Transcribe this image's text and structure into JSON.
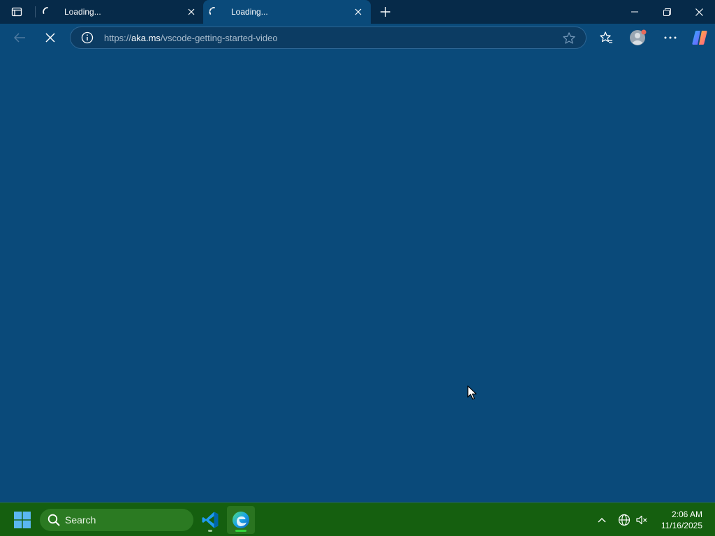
{
  "browser": {
    "tabs": [
      {
        "title": "Loading...",
        "state": "loading",
        "active": false
      },
      {
        "title": "Loading...",
        "state": "loading",
        "active": true
      }
    ],
    "address": {
      "url_prefix": "https://",
      "url_host": "aka.ms",
      "url_path": "/vscode-getting-started-video"
    },
    "icons": {
      "tab_actions": "tab-actions-icon",
      "new_tab": "plus-icon",
      "back": "back-arrow-icon",
      "stop": "close-icon",
      "site_info": "info-icon",
      "favorite": "star-icon",
      "favorites": "favorites-icon",
      "profile": "profile-icon",
      "more": "more-icon",
      "copilot": "copilot-icon"
    }
  },
  "taskbar": {
    "search_label": "Search",
    "apps": [
      {
        "name": "Visual Studio Code",
        "icon": "vscode-icon",
        "running": true,
        "active": false
      },
      {
        "name": "Microsoft Edge",
        "icon": "edge-icon",
        "running": true,
        "active": true
      }
    ],
    "clock": {
      "time": "2:06 AM",
      "date": "11/16/2025"
    }
  },
  "colors": {
    "page_bg": "#0a4a7a",
    "titlebar_bg": "#062a49",
    "taskbar_bg": "#155f0f",
    "accent_green": "#35d43a"
  }
}
